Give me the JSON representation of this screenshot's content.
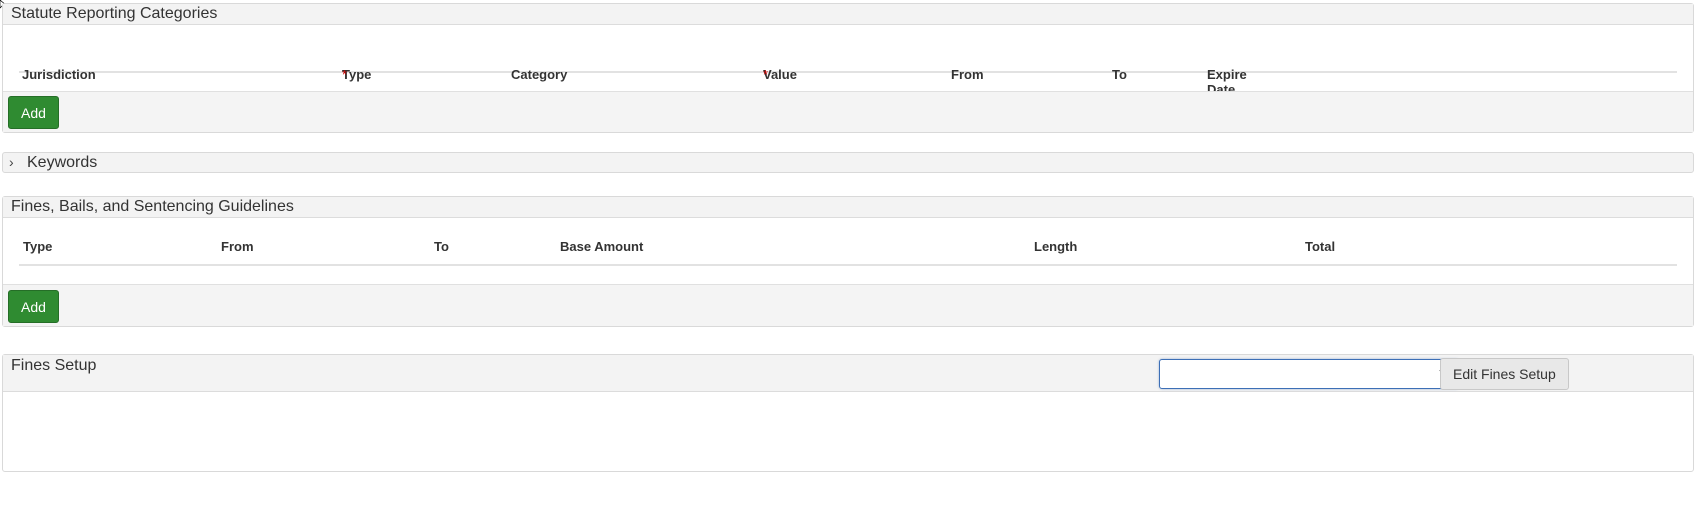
{
  "statute_panel": {
    "title": "Statute Reporting Categories",
    "columns": [
      {
        "label": "Jurisdiction",
        "required": false
      },
      {
        "label": "Type",
        "required": true
      },
      {
        "label": "Category",
        "required": false
      },
      {
        "label": "Value",
        "required": true
      },
      {
        "label": "From",
        "required": false
      },
      {
        "label": "To",
        "required": false
      },
      {
        "label": "Expire Date",
        "required": false
      }
    ],
    "add_label": "Add"
  },
  "keywords_panel": {
    "title": "Keywords"
  },
  "fines_panel": {
    "title": "Fines, Bails, and Sentencing Guidelines",
    "columns": [
      "Type",
      "From",
      "To",
      "Base Amount",
      "Length",
      "Total"
    ],
    "add_label": "Add"
  },
  "fines_setup_panel": {
    "title": "Fines Setup",
    "select_value": "",
    "edit_label": "Edit Fines Setup"
  },
  "required_marker": "*",
  "colors": {
    "add_button": "#2f8b31",
    "required": "#cc0000",
    "select_focus": "#3d6fb6"
  }
}
